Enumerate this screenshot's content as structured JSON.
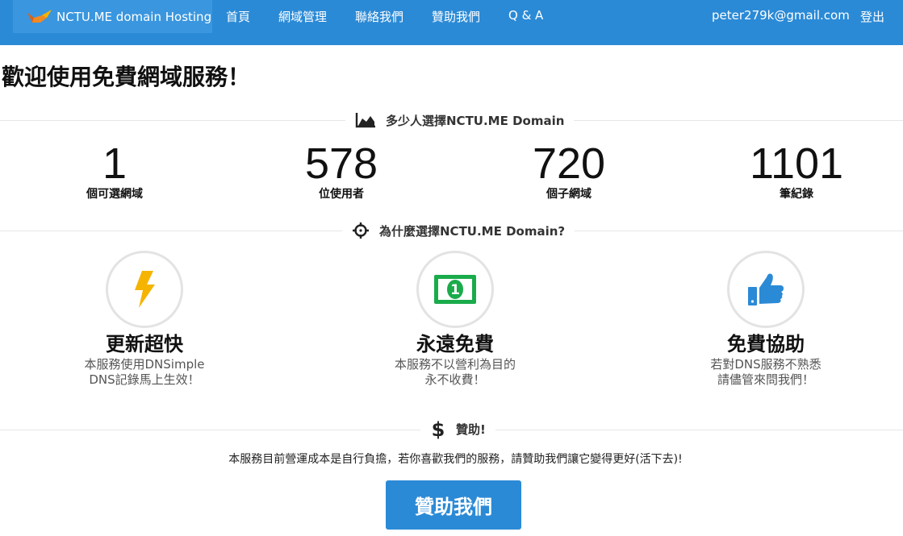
{
  "navbar": {
    "brand": "NCTU.ME domain Hosting",
    "items": [
      {
        "label": "首頁"
      },
      {
        "label": "網域管理"
      },
      {
        "label": "聯絡我們"
      },
      {
        "label": "贊助我們"
      },
      {
        "label": "Q & A"
      }
    ],
    "user_email": "peter279k@gmail.com",
    "logout": "登出"
  },
  "main": {
    "title": "歡迎使用免費網域服務！",
    "stats_heading": "多少人選擇NCTU.ME Domain",
    "stats": [
      {
        "value": "1",
        "label": "個可選網域"
      },
      {
        "value": "578",
        "label": "位使用者"
      },
      {
        "value": "720",
        "label": "個子網域"
      },
      {
        "value": "1101",
        "label": "筆紀錄"
      }
    ],
    "why_heading": "為什麼選擇NCTU.ME Domain?",
    "features": [
      {
        "icon": "lightning-icon",
        "title": "更新超快",
        "desc_line1": "本服務使用DNSimple",
        "desc_line2": "DNS記錄馬上生效！"
      },
      {
        "icon": "money-icon",
        "title": "永遠免費",
        "desc_line1": "本服務不以營利為目的",
        "desc_line2": "永不收費！"
      },
      {
        "icon": "thumbs-up-icon",
        "title": "免費協助",
        "desc_line1": "若對DNS服務不熟悉",
        "desc_line2": "請儘管來問我們！"
      }
    ],
    "donate_heading": "贊助!",
    "donate_text": "本服務目前營運成本是自行負擔，若你喜歡我們的服務，請贊助我們讓它變得更好(活下去)!",
    "donate_button": "贊助我們"
  },
  "colors": {
    "navbar": "#2b8ad6",
    "brand_bg": "#3a96de",
    "lightning": "#f5b400",
    "money": "#1aab4b",
    "thumbs": "#2b8ad6"
  }
}
